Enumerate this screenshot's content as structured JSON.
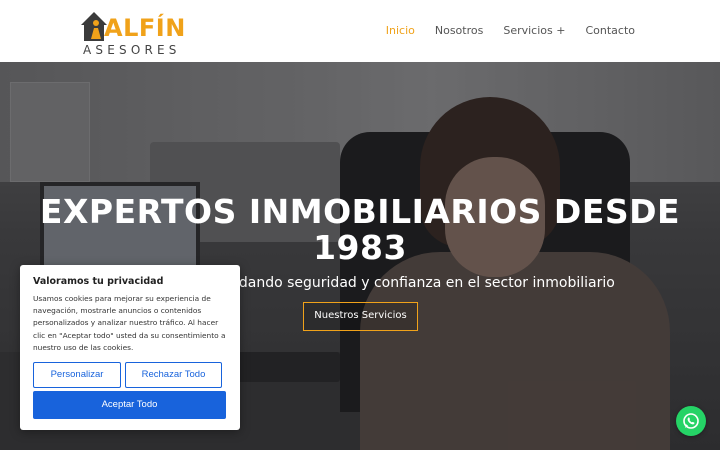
{
  "header": {
    "logo": {
      "word": "ALFÍN",
      "sub": "ASESORES"
    },
    "nav": [
      {
        "label": "Inicio",
        "active": true
      },
      {
        "label": "Nosotros",
        "active": false
      },
      {
        "label": "Servicios +",
        "active": false
      },
      {
        "label": "Contacto",
        "active": false
      }
    ]
  },
  "hero": {
    "title": "EXPERTOS INMOBILIARIOS DESDE 1983",
    "subtitle": "ndando seguridad y confianza en el sector inmobiliario",
    "button_label": "Nuestros Servicios"
  },
  "cookie_banner": {
    "title": "Valoramos tu privacidad",
    "text": "Usamos cookies para mejorar su experiencia de navegación, mostrarle anuncios o contenidos personalizados y analizar nuestro tráfico. Al hacer clic en \"Aceptar todo\" usted da su consentimiento a nuestro uso de las cookies.",
    "buttons": {
      "customize": "Personalizar",
      "reject": "Rechazar Todo",
      "accept": "Aceptar Todo"
    }
  },
  "colors": {
    "accent": "#f0a21a",
    "cookie_blue": "#1863dc",
    "whatsapp_green": "#25d366"
  },
  "icons": {
    "logo": "house-person-icon",
    "floating": "whatsapp-icon"
  }
}
